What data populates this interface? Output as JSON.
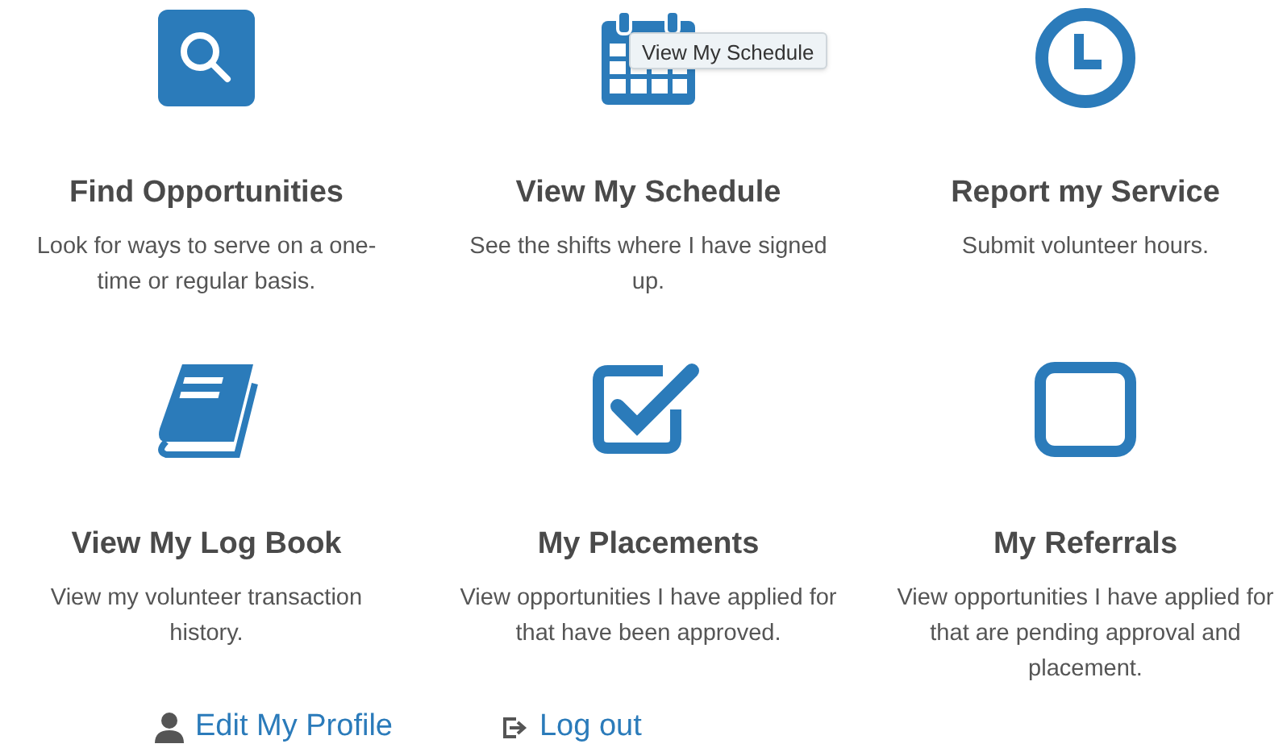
{
  "tiles": [
    {
      "kind": "search",
      "title": "Find Opportunities",
      "description": "Look for ways to serve on a one-time or regular basis."
    },
    {
      "kind": "calendar",
      "title": "View My Schedule",
      "description": "See the shifts where I have signed up."
    },
    {
      "kind": "clock",
      "title": "Report my Service",
      "description": "Submit volunteer hours."
    },
    {
      "kind": "book",
      "title": "View My Log Book",
      "description": "View my volunteer transaction history."
    },
    {
      "kind": "checkbox",
      "title": "My Placements",
      "description": "View opportunities I have applied for that have been approved."
    },
    {
      "kind": "square",
      "title": "My Referrals",
      "description": "View opportunities I have applied for that are pending approval and placement."
    }
  ],
  "tooltip": {
    "text": "View My Schedule"
  },
  "links": [
    {
      "kind": "profile",
      "label": "Edit My Profile"
    },
    {
      "kind": "logout",
      "label": "Log out"
    }
  ]
}
